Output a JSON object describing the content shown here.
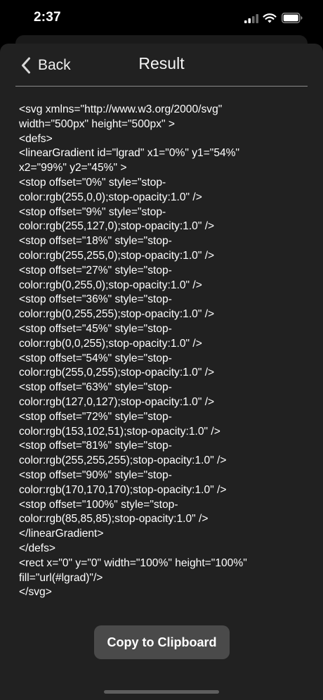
{
  "status_bar": {
    "time": "2:37",
    "signal_icon": "cellular-signal-icon",
    "wifi_icon": "wifi-icon",
    "battery_icon": "battery-icon"
  },
  "nav": {
    "back_label": "Back",
    "back_icon": "chevron-left-icon",
    "title": "Result"
  },
  "result_code": "<svg xmlns=\"http://www.w3.org/2000/svg\"\nwidth=\"500px\" height=\"500px\" >\n<defs>\n<linearGradient id=\"lgrad\" x1=\"0%\" y1=\"54%\"\nx2=\"99%\" y2=\"45%\" >\n<stop offset=\"0%\" style=\"stop-\ncolor:rgb(255,0,0);stop-opacity:1.0\" />\n<stop offset=\"9%\" style=\"stop-\ncolor:rgb(255,127,0);stop-opacity:1.0\" />\n<stop offset=\"18%\" style=\"stop-\ncolor:rgb(255,255,0);stop-opacity:1.0\" />\n<stop offset=\"27%\" style=\"stop-\ncolor:rgb(0,255,0);stop-opacity:1.0\" />\n<stop offset=\"36%\" style=\"stop-\ncolor:rgb(0,255,255);stop-opacity:1.0\" />\n<stop offset=\"45%\" style=\"stop-\ncolor:rgb(0,0,255);stop-opacity:1.0\" />\n<stop offset=\"54%\" style=\"stop-\ncolor:rgb(255,0,255);stop-opacity:1.0\" />\n<stop offset=\"63%\" style=\"stop-\ncolor:rgb(127,0,127);stop-opacity:1.0\" />\n<stop offset=\"72%\" style=\"stop-\ncolor:rgb(153,102,51);stop-opacity:1.0\" />\n<stop offset=\"81%\" style=\"stop-\ncolor:rgb(255,255,255);stop-opacity:1.0\" />\n<stop offset=\"90%\" style=\"stop-\ncolor:rgb(170,170,170);stop-opacity:1.0\" />\n<stop offset=\"100%\" style=\"stop-\ncolor:rgb(85,85,85);stop-opacity:1.0\" />\n</linearGradient>\n</defs>\n<rect x=\"0\" y=\"0\" width=\"100%\" height=\"100%\"\nfill=\"url(#lgrad)\"/>\n</svg>",
  "copy_button_label": "Copy to Clipboard",
  "colors": {
    "background": "#000000",
    "sheet": "#212121",
    "button": "#4a4a4a",
    "text": "#ffffff"
  }
}
